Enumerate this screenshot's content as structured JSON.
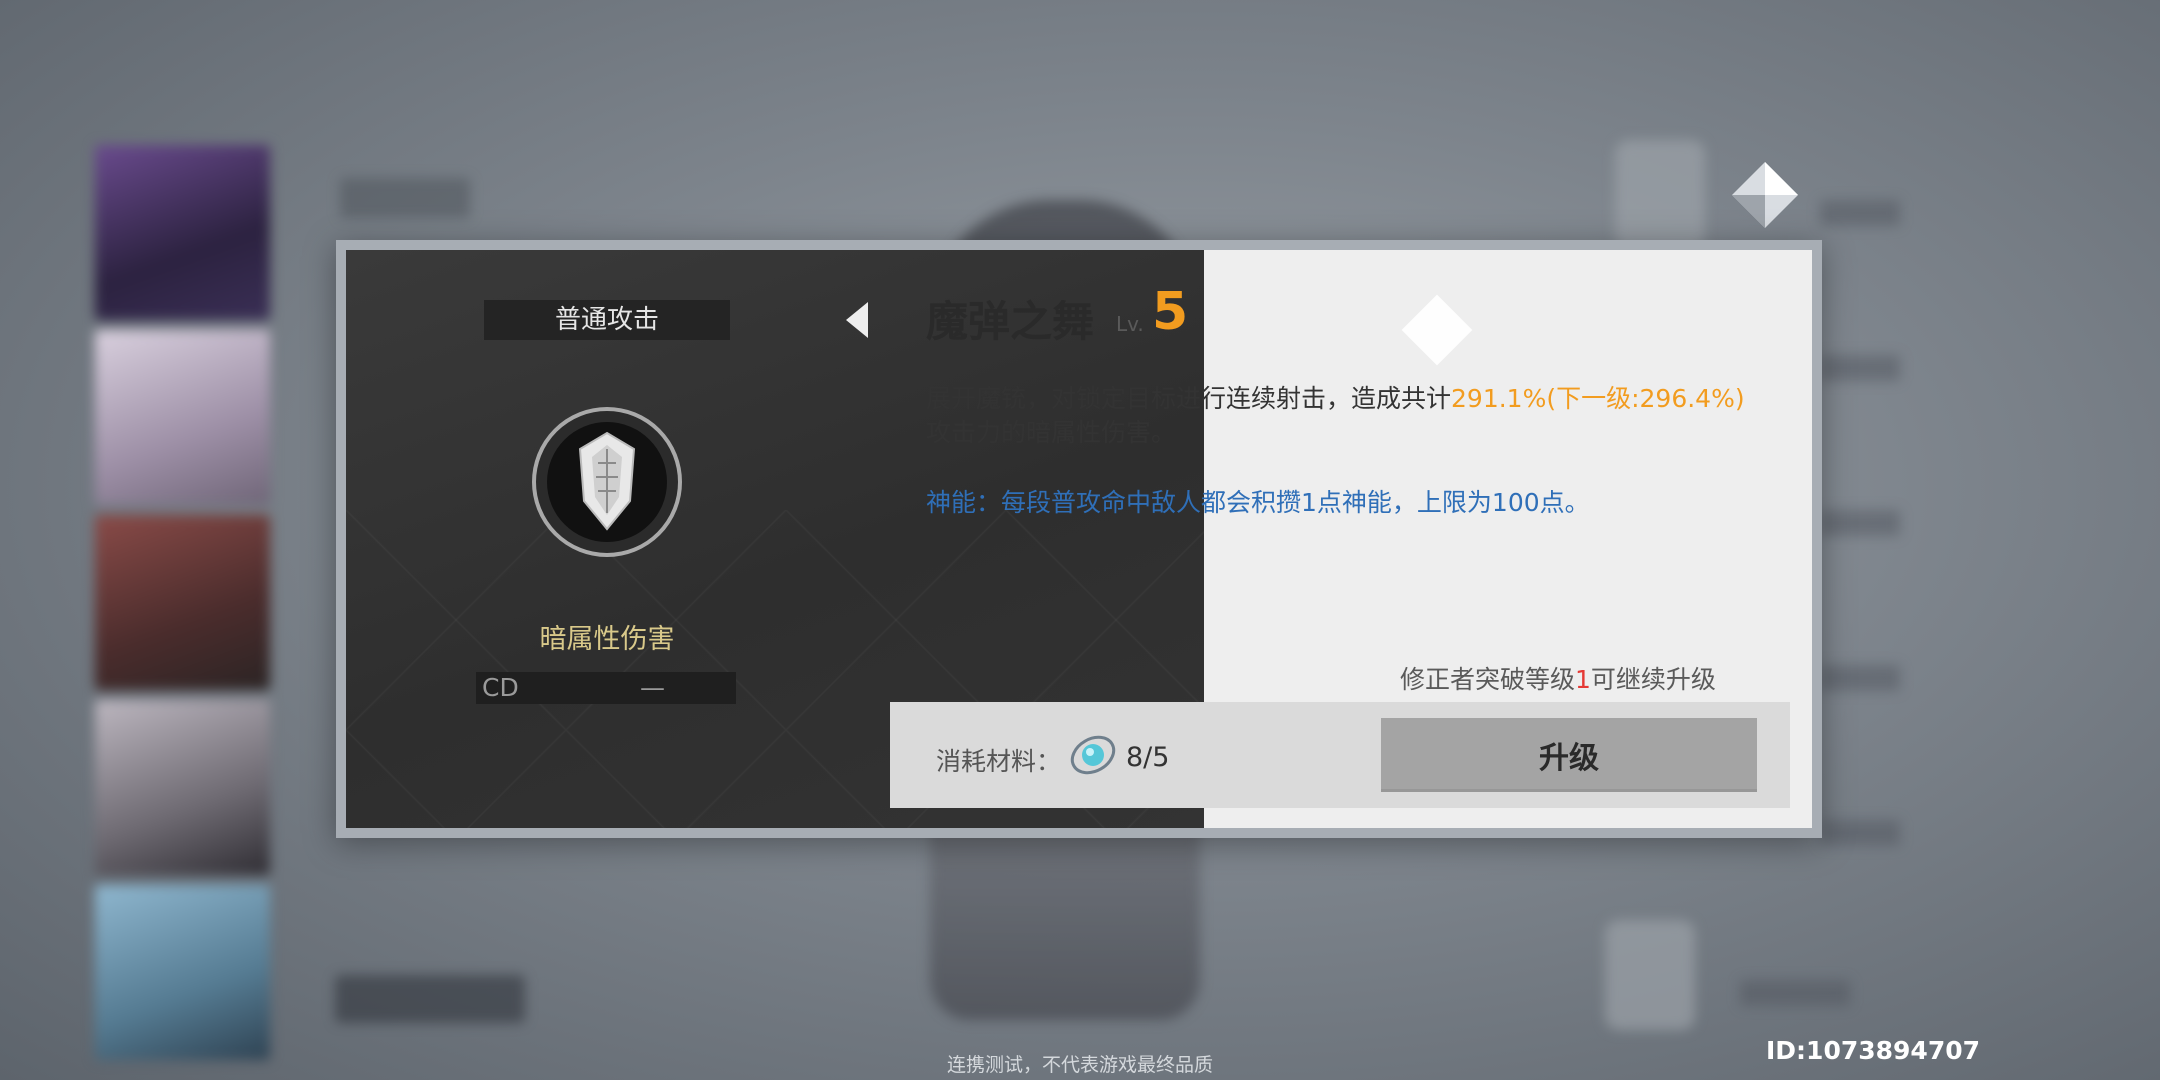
{
  "skill_panel": {
    "type_label": "普通攻击",
    "element": "暗属性伤害",
    "cd_label": "CD",
    "cd_value": "—"
  },
  "skill_detail": {
    "name": "魔弹之舞",
    "level_label": "Lv.",
    "level": "5",
    "description_prefix": "展开魔铳，对锁定目标进行连续射击，造成共计",
    "description_value": "291.1%(下一级:296.4%)",
    "description_suffix": "攻击力的暗属性伤害。",
    "divine_energy": "神能：每段普攻命中敌人都会积攒1点神能，上限为100点。",
    "requirement_prefix": "修正者突破等级",
    "requirement_level": "1",
    "requirement_suffix": "可继续升级"
  },
  "cost": {
    "label": "消耗材料：",
    "count": "8/5",
    "material_icon": "crystal-material-icon"
  },
  "upgrade_button_label": "升级",
  "footer_note": "连携测试，不代表游戏最终品质",
  "uid": "ID:1073894707",
  "colors": {
    "accent_orange": "#f29c1f",
    "divine_blue": "#2f6fb8",
    "element_gold": "#d9c98a",
    "requirement_red": "#e53935"
  }
}
